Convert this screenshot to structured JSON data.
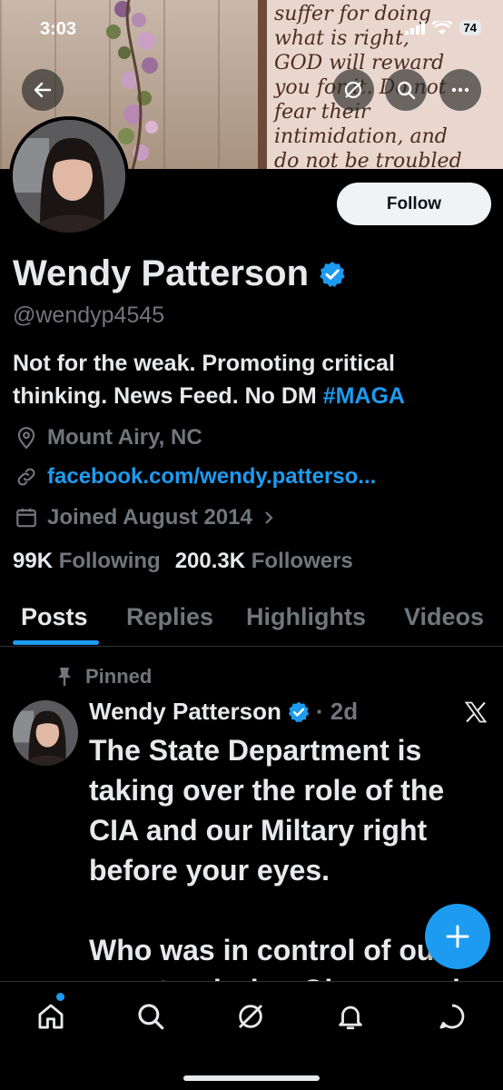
{
  "status_bar": {
    "time": "3:03",
    "battery": "74"
  },
  "banner": {
    "verse_text": "suffer for doing\nwhat is right,\nGOD will reward\nyou for it. Do not\nfear their\nintimidation, and\ndo not be troubled"
  },
  "profile": {
    "display_name": "Wendy Patterson",
    "handle": "@wendyp4545",
    "follow_label": "Follow",
    "bio_text": "Not for the weak. Promoting critical thinking. News Feed. No DM ",
    "bio_hashtag": "#MAGA",
    "location": "Mount Airy, NC",
    "website": "facebook.com/wendy.patterso...",
    "joined": "Joined August 2014",
    "following_count": "99K",
    "following_label": "Following",
    "followers_count": "200.3K",
    "followers_label": "Followers"
  },
  "tabs": [
    {
      "label": "Posts"
    },
    {
      "label": "Replies"
    },
    {
      "label": "Highlights"
    },
    {
      "label": "Videos"
    }
  ],
  "post": {
    "pinned_label": "Pinned",
    "author": "Wendy Patterson",
    "time": "· 2d",
    "body": "The State Department is taking over the role of the CIA and our Miltary right before your eyes.\n\nWho was in control of our country during Obama and"
  },
  "colors": {
    "accent": "#1d9bf0",
    "background": "#000000",
    "text": "#e7e9ea",
    "muted": "#71767b"
  },
  "icons": [
    "back-arrow-icon",
    "grok-icon",
    "search-icon",
    "more-icon",
    "verified-badge-icon",
    "location-icon",
    "link-icon",
    "calendar-icon",
    "chevron-right-icon",
    "pin-icon",
    "x-logo-icon",
    "plus-icon",
    "home-icon",
    "search-nav-icon",
    "grok-nav-icon",
    "bell-icon",
    "messages-icon"
  ]
}
